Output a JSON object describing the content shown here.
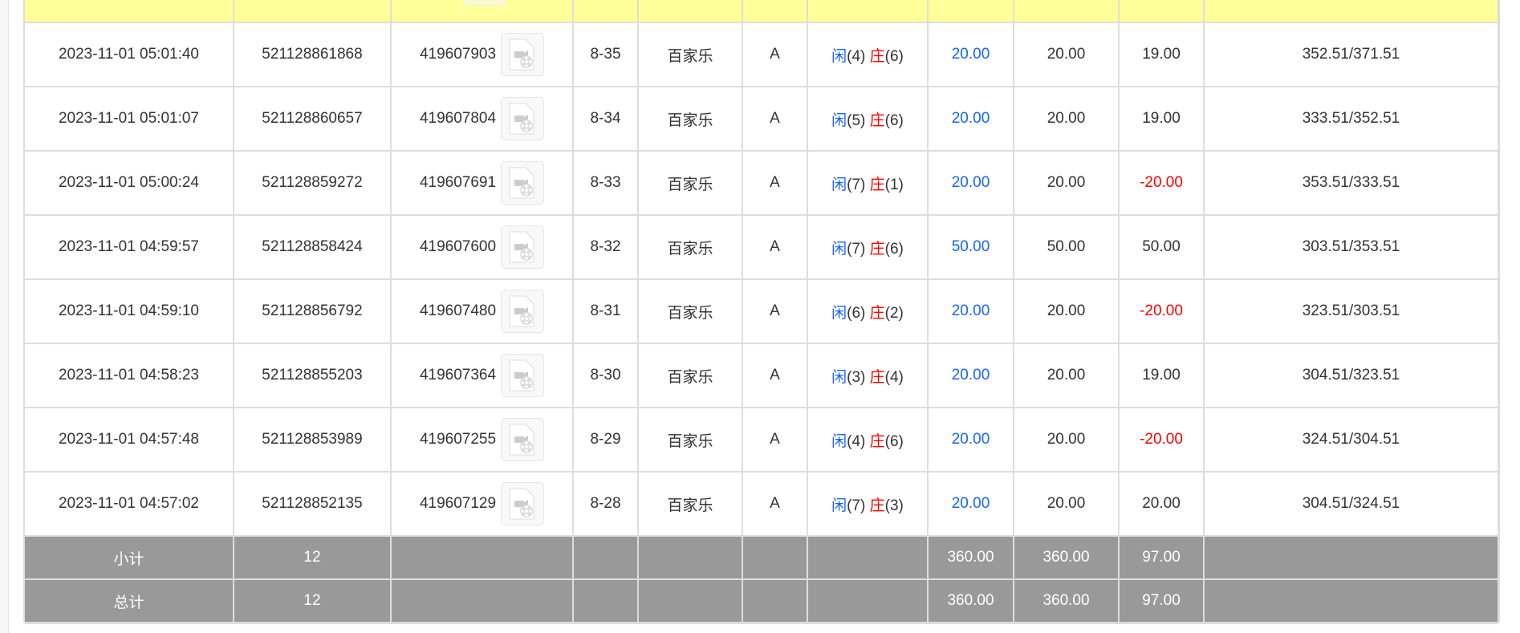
{
  "rows": [
    {
      "time": "2023-11-01 05:01:40",
      "bet_id": "521128861868",
      "round_id": "419607903",
      "shoe": "8-35",
      "game": "百家乐",
      "table": "A",
      "player_label": "闲",
      "player": "(4)",
      "banker_label": "庄",
      "banker": "(6)",
      "bet": "20.00",
      "valid": "20.00",
      "win": "19.00",
      "balance": "352.51/371.51"
    },
    {
      "time": "2023-11-01 05:01:07",
      "bet_id": "521128860657",
      "round_id": "419607804",
      "shoe": "8-34",
      "game": "百家乐",
      "table": "A",
      "player_label": "闲",
      "player": "(5)",
      "banker_label": "庄",
      "banker": "(6)",
      "bet": "20.00",
      "valid": "20.00",
      "win": "19.00",
      "balance": "333.51/352.51"
    },
    {
      "time": "2023-11-01 05:00:24",
      "bet_id": "521128859272",
      "round_id": "419607691",
      "shoe": "8-33",
      "game": "百家乐",
      "table": "A",
      "player_label": "闲",
      "player": "(7)",
      "banker_label": "庄",
      "banker": "(1)",
      "bet": "20.00",
      "valid": "20.00",
      "win": "-20.00",
      "balance": "353.51/333.51"
    },
    {
      "time": "2023-11-01 04:59:57",
      "bet_id": "521128858424",
      "round_id": "419607600",
      "shoe": "8-32",
      "game": "百家乐",
      "table": "A",
      "player_label": "闲",
      "player": "(7)",
      "banker_label": "庄",
      "banker": "(6)",
      "bet": "50.00",
      "valid": "50.00",
      "win": "50.00",
      "balance": "303.51/353.51"
    },
    {
      "time": "2023-11-01 04:59:10",
      "bet_id": "521128856792",
      "round_id": "419607480",
      "shoe": "8-31",
      "game": "百家乐",
      "table": "A",
      "player_label": "闲",
      "player": "(6)",
      "banker_label": "庄",
      "banker": "(2)",
      "bet": "20.00",
      "valid": "20.00",
      "win": "-20.00",
      "balance": "323.51/303.51"
    },
    {
      "time": "2023-11-01 04:58:23",
      "bet_id": "521128855203",
      "round_id": "419607364",
      "shoe": "8-30",
      "game": "百家乐",
      "table": "A",
      "player_label": "闲",
      "player": "(3)",
      "banker_label": "庄",
      "banker": "(4)",
      "bet": "20.00",
      "valid": "20.00",
      "win": "19.00",
      "balance": "304.51/323.51"
    },
    {
      "time": "2023-11-01 04:57:48",
      "bet_id": "521128853989",
      "round_id": "419607255",
      "shoe": "8-29",
      "game": "百家乐",
      "table": "A",
      "player_label": "闲",
      "player": "(4)",
      "banker_label": "庄",
      "banker": "(6)",
      "bet": "20.00",
      "valid": "20.00",
      "win": "-20.00",
      "balance": "324.51/304.51"
    },
    {
      "time": "2023-11-01 04:57:02",
      "bet_id": "521128852135",
      "round_id": "419607129",
      "shoe": "8-28",
      "game": "百家乐",
      "table": "A",
      "player_label": "闲",
      "player": "(7)",
      "banker_label": "庄",
      "banker": "(3)",
      "bet": "20.00",
      "valid": "20.00",
      "win": "20.00",
      "balance": "304.51/324.51"
    }
  ],
  "subtotal": {
    "label": "小计",
    "count": "12",
    "bet": "360.00",
    "valid": "360.00",
    "win": "97.00"
  },
  "total": {
    "label": "总计",
    "count": "12",
    "bet": "360.00",
    "valid": "360.00",
    "win": "97.00"
  },
  "colors": {
    "blue": "#1565ff",
    "red": "#ff0000",
    "highlight": "#ffff99",
    "summary": "#999999"
  }
}
